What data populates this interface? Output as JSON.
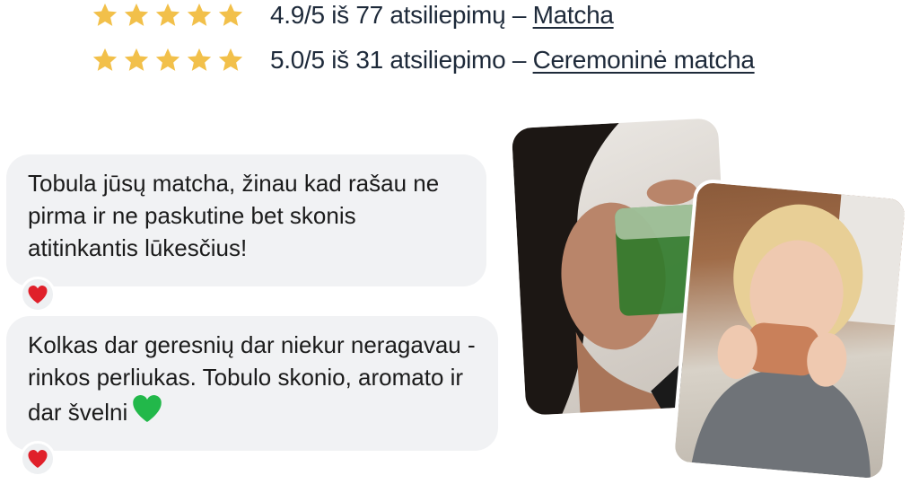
{
  "ratings": [
    {
      "stars": 5,
      "text": "4.9/5 iš 77 atsiliepimų –",
      "link": "Matcha"
    },
    {
      "stars": 5,
      "text": "5.0/5 iš 31 atsiliepimo –",
      "link": "Ceremoninė matcha"
    }
  ],
  "reviews": [
    {
      "text": "Tobula jūsų matcha, žinau kad rašau ne pirma ir ne paskutine bet skonis atitinkantis lūkesčius!",
      "reaction": "❤️"
    },
    {
      "text": "Kolkas dar geresnių dar niekur neragavau - rinkos perliukas. Tobulo skonio, aromato ir dar švelni",
      "trailing_emoji": "💚",
      "reaction": "❤️"
    }
  ],
  "colors": {
    "star": "#f2c04a",
    "text": "#1e2a3a",
    "bubble": "#f1f2f4",
    "heart_red": "#e0202a",
    "heart_green": "#22b84a"
  },
  "icons": {
    "star": "star-icon",
    "reaction": "red-heart-icon",
    "emoji": "green-heart-icon"
  }
}
